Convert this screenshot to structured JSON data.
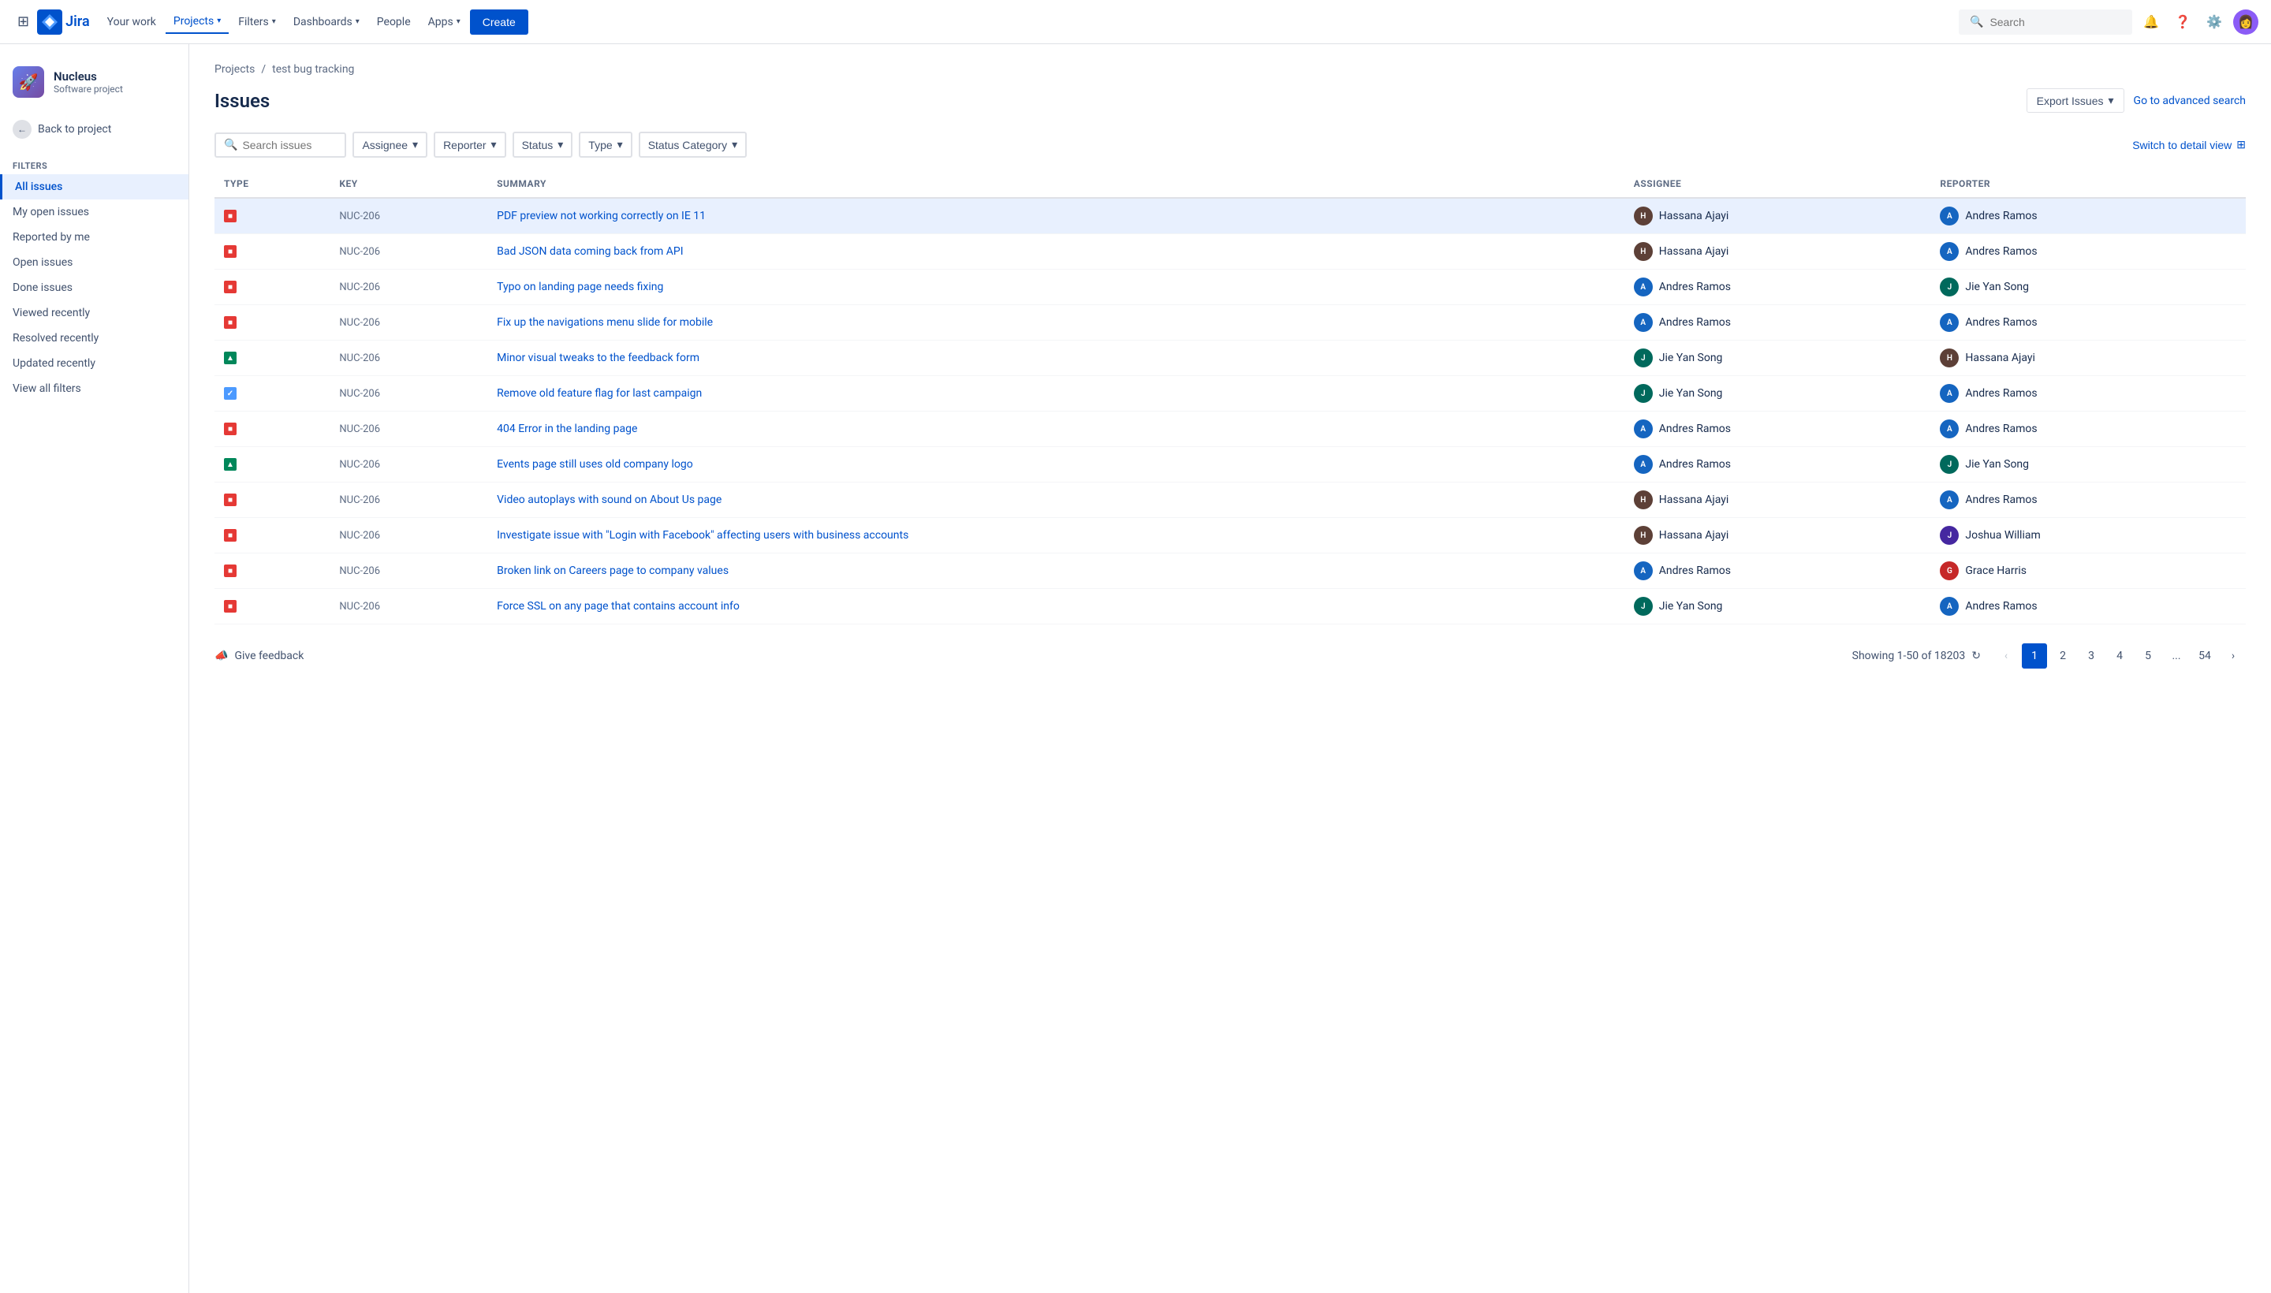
{
  "topnav": {
    "logo_text": "Jira",
    "your_work": "Your work",
    "projects": "Projects",
    "filters": "Filters",
    "dashboards": "Dashboards",
    "people": "People",
    "apps": "Apps",
    "create": "Create",
    "search_placeholder": "Search"
  },
  "sidebar": {
    "project_name": "Nucleus",
    "project_type": "Software project",
    "back_label": "Back to project",
    "section_label": "Filters",
    "items": [
      {
        "id": "all-issues",
        "label": "All issues",
        "active": true
      },
      {
        "id": "my-open-issues",
        "label": "My open issues",
        "active": false
      },
      {
        "id": "reported-by-me",
        "label": "Reported by me",
        "active": false
      },
      {
        "id": "open-issues",
        "label": "Open issues",
        "active": false
      },
      {
        "id": "done-issues",
        "label": "Done issues",
        "active": false
      },
      {
        "id": "viewed-recently",
        "label": "Viewed recently",
        "active": false
      },
      {
        "id": "resolved-recently",
        "label": "Resolved recently",
        "active": false
      },
      {
        "id": "updated-recently",
        "label": "Updated recently",
        "active": false
      },
      {
        "id": "view-all-filters",
        "label": "View all filters",
        "active": false
      }
    ]
  },
  "breadcrumb": {
    "projects": "Projects",
    "separator": "/",
    "current": "test bug tracking"
  },
  "page": {
    "title": "Issues",
    "export_label": "Export Issues",
    "advanced_search": "Go to advanced search",
    "detail_view": "Switch to detail view"
  },
  "filters": {
    "search_placeholder": "Search issues",
    "assignee": "Assignee",
    "reporter": "Reporter",
    "status": "Status",
    "type": "Type",
    "status_category": "Status Category"
  },
  "table": {
    "columns": [
      "Type",
      "Key",
      "Summary",
      "Assignee",
      "Reporter"
    ],
    "rows": [
      {
        "type": "bug",
        "key": "NUC-206",
        "summary": "PDF preview not working correctly on IE 11",
        "assignee": "Hassana Ajayi",
        "assignee_color": "#5d4037",
        "reporter": "Andres Ramos",
        "reporter_color": "#1565c0",
        "selected": true
      },
      {
        "type": "bug",
        "key": "NUC-206",
        "summary": "Bad JSON data coming back from API",
        "assignee": "Hassana Ajayi",
        "assignee_color": "#5d4037",
        "reporter": "Andres Ramos",
        "reporter_color": "#1565c0",
        "selected": false
      },
      {
        "type": "bug",
        "key": "NUC-206",
        "summary": "Typo on landing page needs fixing",
        "assignee": "Andres Ramos",
        "assignee_color": "#1565c0",
        "reporter": "Jie Yan Song",
        "reporter_color": "#00695c",
        "selected": false
      },
      {
        "type": "bug",
        "key": "NUC-206",
        "summary": "Fix up the navigations menu slide for mobile",
        "assignee": "Andres Ramos",
        "assignee_color": "#1565c0",
        "reporter": "Andres Ramos",
        "reporter_color": "#1565c0",
        "selected": false
      },
      {
        "type": "improvement",
        "key": "NUC-206",
        "summary": "Minor visual tweaks to the feedback form",
        "assignee": "Jie Yan Song",
        "assignee_color": "#00695c",
        "reporter": "Hassana Ajayi",
        "reporter_color": "#5d4037",
        "selected": false
      },
      {
        "type": "task",
        "key": "NUC-206",
        "summary": "Remove old feature flag for last campaign",
        "assignee": "Jie Yan Song",
        "assignee_color": "#00695c",
        "reporter": "Andres Ramos",
        "reporter_color": "#1565c0",
        "selected": false
      },
      {
        "type": "bug",
        "key": "NUC-206",
        "summary": "404 Error in the landing page",
        "assignee": "Andres Ramos",
        "assignee_color": "#1565c0",
        "reporter": "Andres Ramos",
        "reporter_color": "#1565c0",
        "selected": false
      },
      {
        "type": "improvement",
        "key": "NUC-206",
        "summary": "Events page still uses old company logo",
        "assignee": "Andres Ramos",
        "assignee_color": "#1565c0",
        "reporter": "Jie Yan Song",
        "reporter_color": "#00695c",
        "selected": false
      },
      {
        "type": "bug",
        "key": "NUC-206",
        "summary": "Video autoplays with sound on About Us page",
        "assignee": "Hassana Ajayi",
        "assignee_color": "#5d4037",
        "reporter": "Andres Ramos",
        "reporter_color": "#1565c0",
        "selected": false
      },
      {
        "type": "bug",
        "key": "NUC-206",
        "summary": "Investigate issue with \"Login with Facebook\" affecting users with business accounts",
        "assignee": "Hassana Ajayi",
        "assignee_color": "#5d4037",
        "reporter": "Joshua William",
        "reporter_color": "#4527a0",
        "selected": false
      },
      {
        "type": "bug",
        "key": "NUC-206",
        "summary": "Broken link on Careers page to company values",
        "assignee": "Andres Ramos",
        "assignee_color": "#1565c0",
        "reporter": "Grace Harris",
        "reporter_color": "#c62828",
        "selected": false
      },
      {
        "type": "bug",
        "key": "NUC-206",
        "summary": "Force SSL on any page that contains account info",
        "assignee": "Jie Yan Song",
        "assignee_color": "#00695c",
        "reporter": "Andres Ramos",
        "reporter_color": "#1565c0",
        "selected": false
      }
    ]
  },
  "pagination": {
    "showing": "Showing 1-50 of 18203",
    "pages": [
      "1",
      "2",
      "3",
      "4",
      "5",
      "...",
      "54"
    ],
    "current_page": "1",
    "prev_disabled": true,
    "next_disabled": false
  },
  "footer": {
    "feedback": "Give feedback"
  }
}
